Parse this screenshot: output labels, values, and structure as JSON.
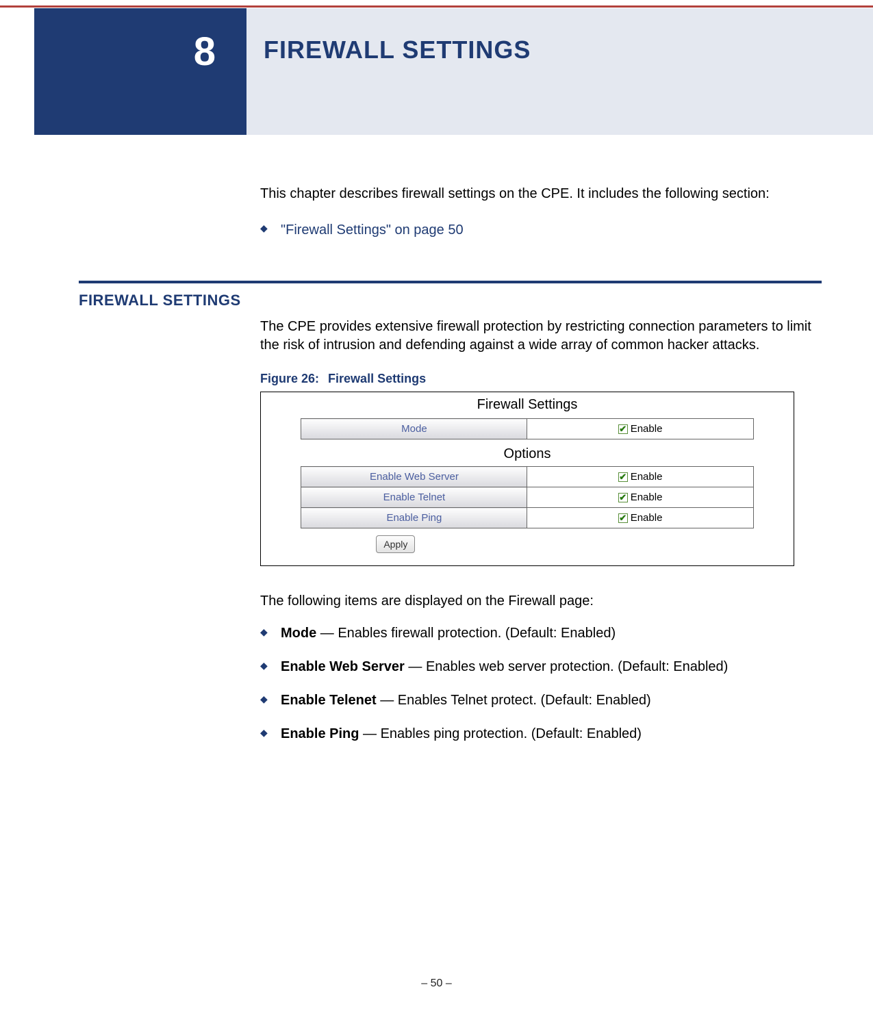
{
  "chapter": {
    "number": "8",
    "title": "FIREWALL SETTINGS"
  },
  "intro": "This chapter describes firewall settings on the CPE. It includes the following section:",
  "intro_links": [
    "\"Firewall Settings\" on page 50"
  ],
  "section": {
    "heading": "FIREWALL SETTINGS",
    "para": "The CPE provides extensive firewall protection by restricting connection parameters to limit the risk of intrusion and defending against a wide array of common hacker attacks."
  },
  "figure": {
    "caption_num": "Figure 26:",
    "caption_title": "Firewall Settings",
    "panel_title": "Firewall Settings",
    "mode_label": "Mode",
    "enable_text": "Enable",
    "options_title": "Options",
    "option_rows": [
      "Enable Web Server",
      "Enable Telnet",
      "Enable Ping"
    ],
    "apply_label": "Apply"
  },
  "items_intro": "The following items are displayed on the Firewall page:",
  "items": [
    {
      "term": "Mode",
      "desc": " — Enables firewall protection. (Default: Enabled)"
    },
    {
      "term": "Enable Web Server",
      "desc": " — Enables web server protection. (Default: Enabled)"
    },
    {
      "term": "Enable Telenet",
      "desc": " — Enables Telnet protect. (Default: Enabled)"
    },
    {
      "term": "Enable Ping",
      "desc": " — Enables ping protection. (Default: Enabled)"
    }
  ],
  "footer": "–  50  –"
}
